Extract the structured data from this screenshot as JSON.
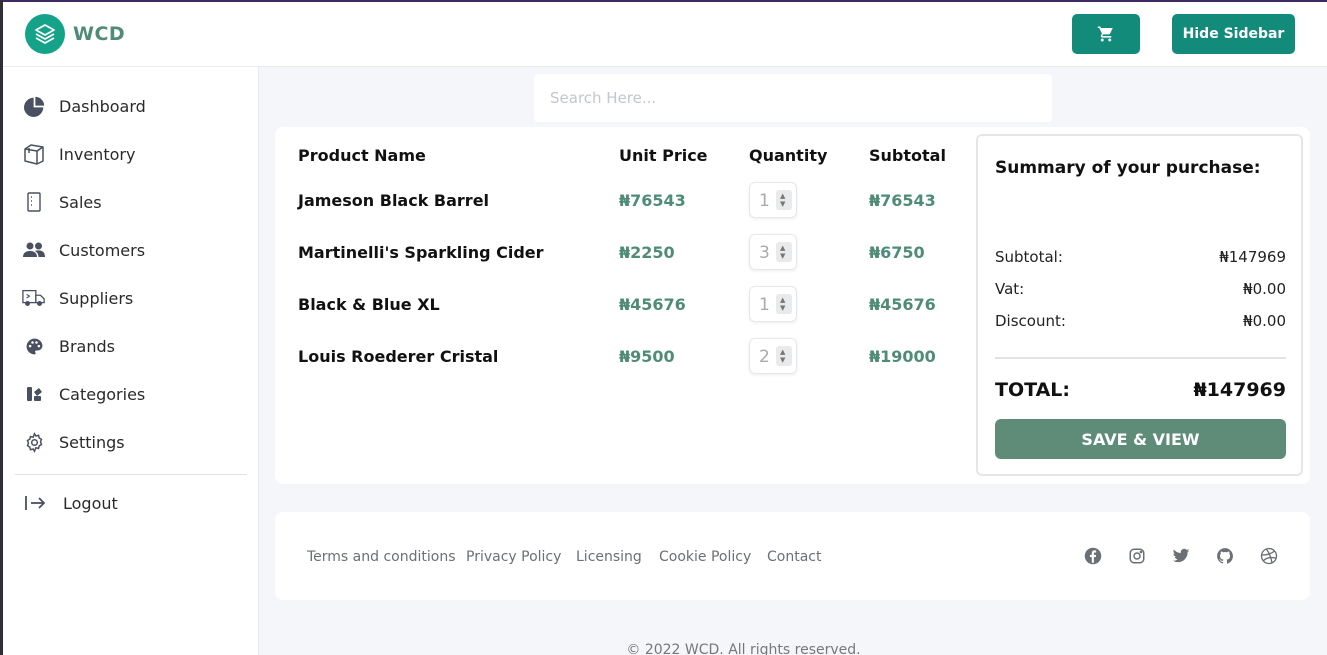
{
  "header": {
    "brand": "WCD",
    "hide_sidebar_label": "Hide Sidebar",
    "accent": "#138b7b"
  },
  "sidebar": {
    "items": [
      {
        "label": "Dashboard",
        "icon": "pie-chart-icon"
      },
      {
        "label": "Inventory",
        "icon": "box-icon"
      },
      {
        "label": "Sales",
        "icon": "receipt-icon"
      },
      {
        "label": "Customers",
        "icon": "users-icon"
      },
      {
        "label": "Suppliers",
        "icon": "truck-icon"
      },
      {
        "label": "Brands",
        "icon": "palette-icon"
      },
      {
        "label": "Categories",
        "icon": "shapes-icon"
      },
      {
        "label": "Settings",
        "icon": "gear-icon"
      }
    ],
    "logout": "Logout"
  },
  "search": {
    "placeholder": "Search Here..."
  },
  "table": {
    "headers": [
      "Product Name",
      "Unit Price",
      "Quantity",
      "Subtotal"
    ],
    "rows": [
      {
        "name": "Jameson Black Barrel",
        "price": "₦76543",
        "qty": "1",
        "subtotal": "₦76543"
      },
      {
        "name": "Martinelli's Sparkling Cider",
        "price": "₦2250",
        "qty": "3",
        "subtotal": "₦6750"
      },
      {
        "name": "Black & Blue XL",
        "price": "₦45676",
        "qty": "1",
        "subtotal": "₦45676"
      },
      {
        "name": "Louis Roederer Cristal",
        "price": "₦9500",
        "qty": "2",
        "subtotal": "₦19000"
      }
    ]
  },
  "summary": {
    "title": "Summary of your purchase:",
    "subtotal_label": "Subtotal:",
    "subtotal": "₦147969",
    "vat_label": "Vat:",
    "vat": "₦0.00",
    "discount_label": "Discount:",
    "discount": "₦0.00",
    "total_label": "TOTAL:",
    "total": "₦147969",
    "save_label": "SAVE & VIEW"
  },
  "footer": {
    "links": [
      "Terms and conditions",
      "Privacy Policy",
      "Licensing",
      "Cookie Policy",
      "Contact"
    ],
    "social": [
      "facebook-icon",
      "instagram-icon",
      "twitter-icon",
      "github-icon",
      "dribbble-icon"
    ],
    "copyright": "© 2022 WCD. All rights reserved."
  }
}
